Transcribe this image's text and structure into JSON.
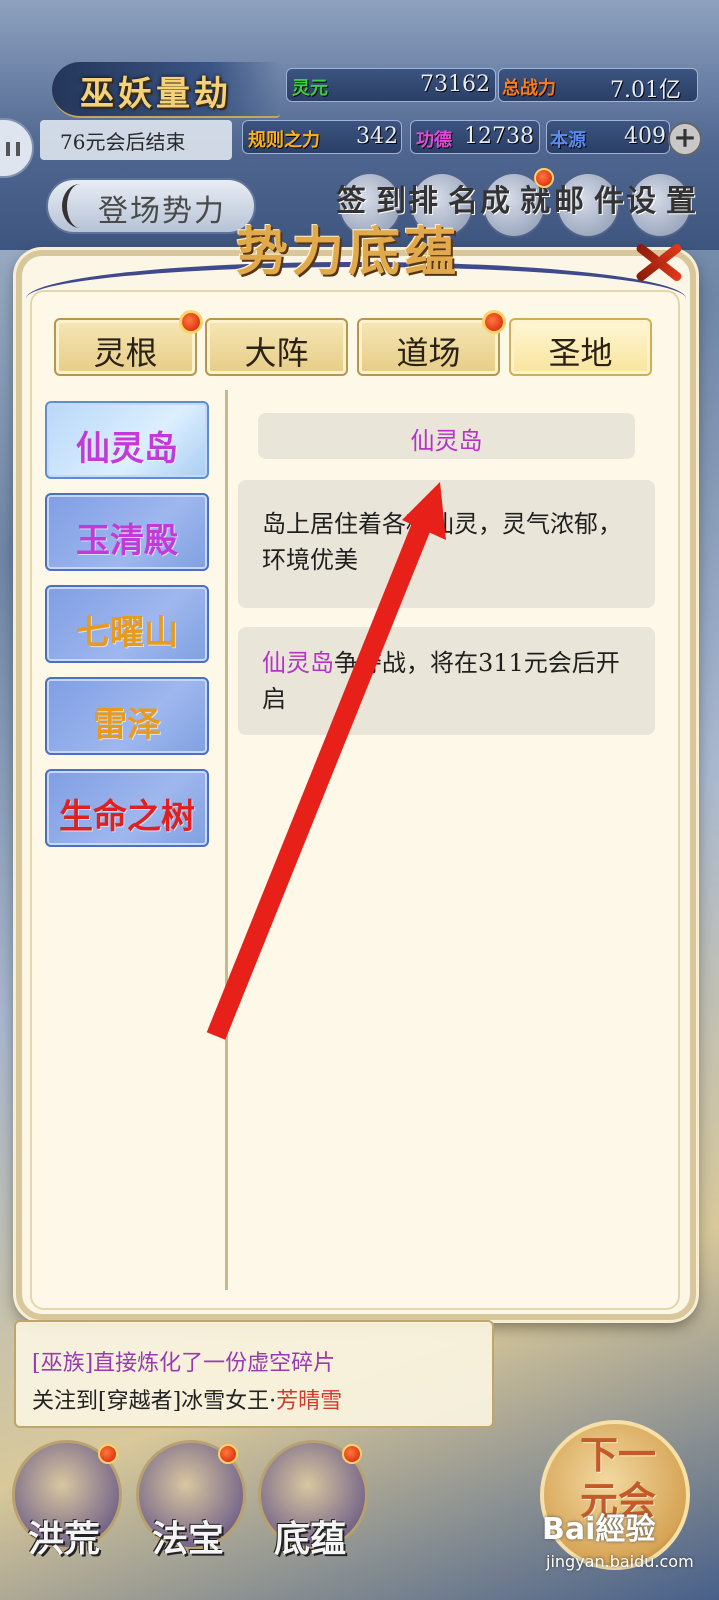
{
  "hud": {
    "title": "巫妖量劫",
    "countdown": "76元会后结束",
    "stats": [
      {
        "label": "灵元",
        "value": "73162",
        "color": "#3fcf3f"
      },
      {
        "label": "总战力",
        "value": "7.01亿",
        "color": "#ff7a1a"
      },
      {
        "label": "规则之力",
        "value": "342",
        "color": "#ffb01a"
      },
      {
        "label": "功德",
        "value": "12738",
        "color": "#e34ad8"
      },
      {
        "label": "本源",
        "value": "409",
        "color": "#5a8cf0"
      }
    ],
    "enter_button": "登场势力",
    "top_buttons": [
      {
        "label": "签到",
        "badge": false
      },
      {
        "label": "排名",
        "badge": false
      },
      {
        "label": "成就",
        "badge": true
      },
      {
        "label": "邮件",
        "badge": false
      },
      {
        "label": "设置",
        "badge": false
      }
    ],
    "plus_icon": "+"
  },
  "modal": {
    "title": "势力底蕴",
    "tabs": [
      {
        "label": "灵根",
        "badge": true,
        "active": false
      },
      {
        "label": "大阵",
        "badge": false,
        "active": false
      },
      {
        "label": "道场",
        "badge": true,
        "active": false
      },
      {
        "label": "圣地",
        "badge": false,
        "active": true
      }
    ],
    "places": [
      {
        "label": "仙灵岛",
        "color": "#c43ad8",
        "active": true
      },
      {
        "label": "玉清殿",
        "color": "#c43ad8",
        "active": false
      },
      {
        "label": "七曜山",
        "color": "#e89a1a",
        "active": false
      },
      {
        "label": "雷泽",
        "color": "#e89a1a",
        "active": false
      },
      {
        "label": "生命之树",
        "color": "#e02020",
        "active": false
      }
    ],
    "detail": {
      "name": "仙灵岛",
      "description": "岛上居住着各种仙灵，灵气浓郁，环境优美",
      "battle_name": "仙灵岛",
      "battle_text": "争夺战，将在311元会后开启"
    }
  },
  "log": {
    "line1": "[巫族]直接炼化了一份虚空碎片",
    "line2_prefix": "关注到[穿越者]冰雪女王·",
    "line2_name": "芳晴雪"
  },
  "bottom_nav": [
    {
      "label": "洪荒",
      "badge": true
    },
    {
      "label": "法宝",
      "badge": true
    },
    {
      "label": "底蕴",
      "badge": true
    }
  ],
  "next_button": "下一元会",
  "watermark": {
    "brand": "Bai經验",
    "url": "jingyan.baidu.com"
  },
  "annotation": {
    "arrow_color": "#e8201a"
  }
}
